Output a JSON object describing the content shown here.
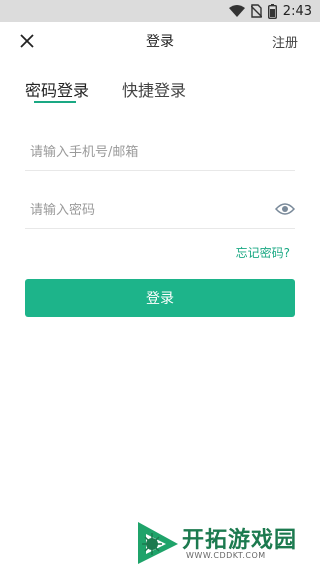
{
  "status_bar": {
    "time": "2:43",
    "icons": [
      "wifi-icon",
      "no-sim-icon",
      "battery-icon"
    ]
  },
  "header": {
    "title": "登录",
    "close_icon": "close-icon",
    "register_label": "注册"
  },
  "tabs": [
    {
      "label": "密码登录",
      "active": true
    },
    {
      "label": "快捷登录",
      "active": false
    }
  ],
  "form": {
    "account_placeholder": "请输入手机号/邮箱",
    "account_value": "",
    "password_placeholder": "请输入密码",
    "password_value": "",
    "password_toggle_icon": "eye-icon",
    "forgot_label": "忘记密码?",
    "submit_label": "登录"
  },
  "watermark": {
    "title": "开拓游戏园",
    "url": "WWW.CDDKT.COM"
  },
  "colors": {
    "accent": "#1db48a",
    "link": "#1aa883",
    "status_bar_bg": "#dcdcdc"
  }
}
